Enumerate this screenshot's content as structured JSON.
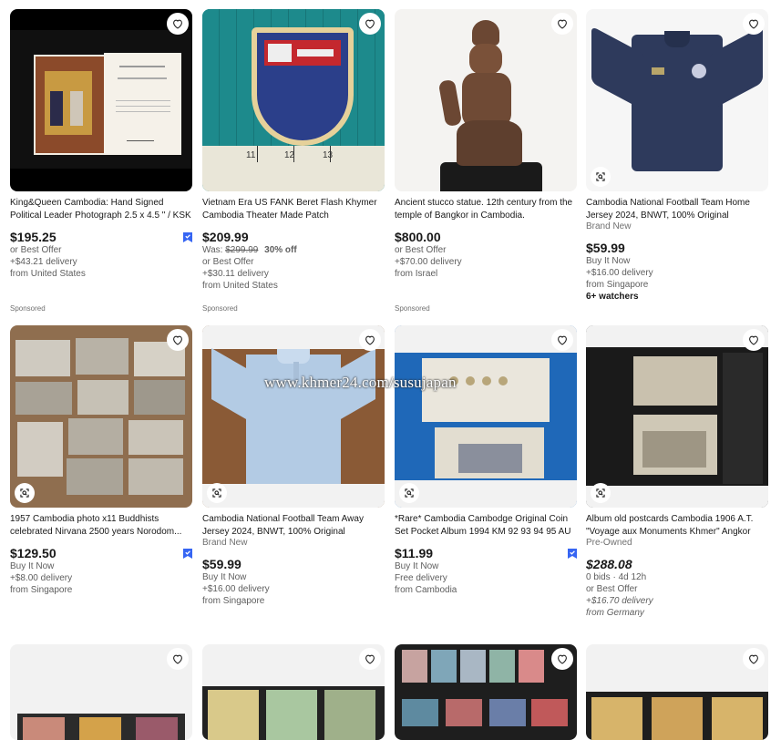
{
  "items": [
    {
      "title": "King&Queen Cambodia: Hand Signed Political Leader Photograph 2.5 x 4.5 \" / KSK",
      "price": "$195.25",
      "lines": [
        "or Best Offer",
        "+$43.21 delivery",
        "from United States"
      ],
      "sponsored": "Sponsored"
    },
    {
      "title": "Vietnam Era US FANK Beret Flash Khymer Cambodia Theater Made Patch",
      "price": "$209.99",
      "was_label": "Was:",
      "was_price": "$299.99",
      "discount": "30% off",
      "lines": [
        "or Best Offer",
        "+$30.11 delivery",
        "from United States"
      ],
      "sponsored": "Sponsored"
    },
    {
      "title": "Ancient stucco statue. 12th century from the temple of Bangkor in Cambodia.",
      "price": "$800.00",
      "lines": [
        "or Best Offer",
        "+$70.00 delivery",
        "from Israel"
      ],
      "sponsored": "Sponsored"
    },
    {
      "title": "Cambodia National Football Team Home Jersey 2024, BNWT, 100% Original",
      "condition": "Brand New",
      "price": "$59.99",
      "lines": [
        "Buy It Now",
        "+$16.00 delivery",
        "from Singapore"
      ],
      "watchers": "6+ watchers"
    },
    {
      "title": "1957 Cambodia photo x11 Buddhists celebrated Nirvana 2500 years Norodom...",
      "price": "$129.50",
      "lines": [
        "Buy It Now",
        "+$8.00 delivery",
        "from Singapore"
      ]
    },
    {
      "title": "Cambodia National Football Team Away Jersey 2024, BNWT, 100% Original",
      "condition": "Brand New",
      "price": "$59.99",
      "lines": [
        "Buy It Now",
        "+$16.00 delivery",
        "from Singapore"
      ]
    },
    {
      "title": "*Rare* Cambodia Cambodge Original Coin Set Pocket Album 1994 KM 92 93 94 95 AU",
      "price": "$11.99",
      "lines": [
        "Buy It Now",
        "Free delivery",
        "from Cambodia"
      ]
    },
    {
      "title": "Album old postcards Cambodia 1906 A.T. \"Voyage aux Monuments Khmer\" Angkor",
      "condition": "Pre-Owned",
      "price": "$288.08",
      "lines": [
        "0 bids · 4d 12h",
        "or Best Offer",
        "+$16.70 delivery",
        "from Germany"
      ]
    }
  ],
  "watermark": "www.khmer24.com/susujapan",
  "icons": {
    "favorite": "heart-icon",
    "visual_search": "camera-search-icon",
    "authenticity": "authenticity-badge-icon"
  },
  "colors": {
    "accent": "#3665f3",
    "text": "#191919",
    "muted": "#5e5e5e",
    "card_bg": "#f2f2f2"
  }
}
